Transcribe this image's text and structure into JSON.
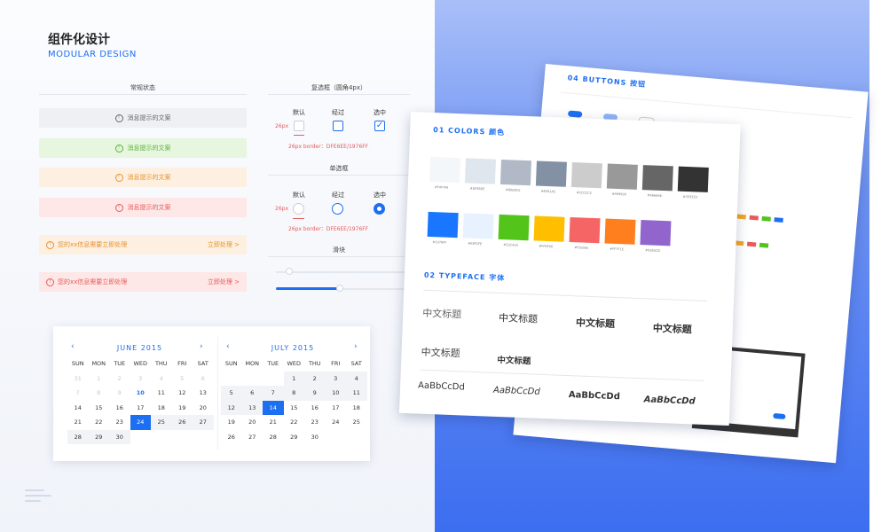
{
  "header": {
    "title_cn": "组件化设计",
    "title_en": "MODULAR DESIGN"
  },
  "alerts": {
    "section_label": "常规状态",
    "items": [
      {
        "text": "消息提示的文案",
        "variant": "gray"
      },
      {
        "text": "消息提示的文案",
        "variant": "green"
      },
      {
        "text": "消息提示的文案",
        "variant": "orange"
      },
      {
        "text": "消息提示的文案",
        "variant": "red"
      }
    ],
    "notices": [
      {
        "text": "您的xx信息需要立即处理",
        "action": "立即处理 >",
        "variant": "orange"
      },
      {
        "text": "您的xx信息需要立即处理",
        "action": "立即处理 >",
        "variant": "red"
      }
    ]
  },
  "checkbox": {
    "section_label": "复选框（圆角4px）",
    "states": [
      "默认",
      "经过",
      "选中"
    ],
    "size": "26px",
    "spec": "26px  border：DFE6EE/1976FF"
  },
  "radio": {
    "section_label": "单选框",
    "states": [
      "默认",
      "经过",
      "选中"
    ],
    "size": "26px",
    "spec": "26px  border：DFE6EE/1976FF"
  },
  "slider": {
    "section_label": "滑块",
    "value_fraction_a": 0.0,
    "value_fraction_b": 0.48
  },
  "calendar": {
    "weekdays": [
      "SUN",
      "MON",
      "TUE",
      "WED",
      "THU",
      "FRI",
      "SAT"
    ],
    "left": {
      "title": "JUNE 2015",
      "days": [
        [
          "31",
          "1",
          "2",
          "3",
          "4",
          "5",
          "6"
        ],
        [
          "7",
          "8",
          "9",
          "10",
          "11",
          "12",
          "13"
        ],
        [
          "14",
          "15",
          "16",
          "17",
          "18",
          "19",
          "20"
        ],
        [
          "21",
          "22",
          "23",
          "24",
          "25",
          "26",
          "27"
        ],
        [
          "28",
          "29",
          "30",
          "",
          "",
          "",
          ""
        ]
      ]
    },
    "right": {
      "title": "JULY 2015",
      "days": [
        [
          "",
          "",
          "",
          "1",
          "2",
          "3",
          "4"
        ],
        [
          "5",
          "6",
          "7",
          "8",
          "9",
          "10",
          "11"
        ],
        [
          "12",
          "13",
          "14",
          "15",
          "16",
          "17",
          "18"
        ],
        [
          "19",
          "20",
          "21",
          "22",
          "23",
          "24",
          "25"
        ],
        [
          "26",
          "27",
          "28",
          "29",
          "30",
          "",
          ""
        ]
      ]
    },
    "prev_icon": "‹",
    "next_icon": "›"
  },
  "cards": {
    "buttons_title": "04 BUTTONS 按钮",
    "colors_title": "01 COLORS 颜色",
    "typeface_title": "02 TYPEFACE 字体",
    "colors": {
      "row1": [
        "#F4F7FA",
        "#DFE6EE",
        "#B0B9C5",
        "#8391A5",
        "#CCCCCC",
        "#999999",
        "#666666",
        "#333333"
      ],
      "row2": [
        "#1976FF",
        "#E8F2FE",
        "#52C41A",
        "#FFBF00",
        "#F56565",
        "#FF7F1E",
        "#9265CD"
      ],
      "row1_labels": [
        "#F4F7FA",
        "#DFE6EE",
        "#B0B9C5",
        "#8391A5",
        "#CCCCCC",
        "#999999",
        "#666666",
        "#333333"
      ],
      "row2_labels": [
        "#1976FF",
        "#E8F2FE",
        "#52C41A",
        "#FFBF00",
        "#F56565",
        "#FF7F1E",
        "#9265CD"
      ]
    },
    "typeface": {
      "cn_samples": [
        "中文标题",
        "中文标题",
        "中文标题",
        "中文标题"
      ],
      "cn_samples2": [
        "中文标题",
        "中文标题"
      ],
      "en_samples": [
        "AaBbCcDd",
        "AaBbCcDd",
        "AaBbCcDd",
        "AaBbCcDd"
      ]
    }
  }
}
